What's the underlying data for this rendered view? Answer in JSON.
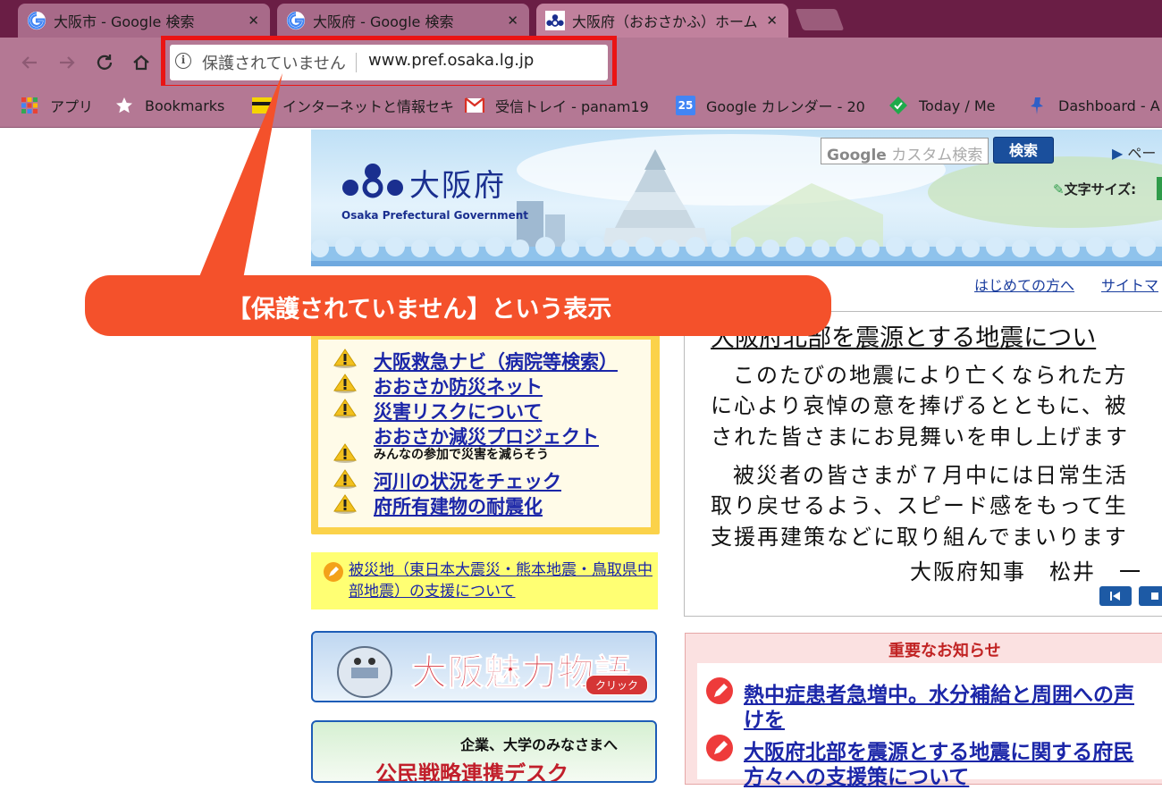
{
  "browser": {
    "tabs": [
      {
        "title": "大阪市 - Google 検索",
        "icon": "google-icon",
        "active": false
      },
      {
        "title": "大阪府 - Google 検索",
        "icon": "google-icon",
        "active": false
      },
      {
        "title": "大阪府（おおさかふ）ホーム",
        "icon": "osaka-pref-icon",
        "active": true
      }
    ],
    "close_glyph": "✕",
    "security_label": "保護されていません",
    "url": "www.pref.osaka.lg.jp",
    "bookmarks": [
      {
        "label": "アプリ",
        "icon": "apps-grid-icon"
      },
      {
        "label": "Bookmarks",
        "icon": "star-icon"
      },
      {
        "label": "インターネットと情報セキ",
        "icon": "internet-watch-icon"
      },
      {
        "label": "受信トレイ - panam19",
        "icon": "gmail-icon"
      },
      {
        "label": "Google カレンダー - 20",
        "icon": "calendar-icon"
      },
      {
        "label": "Today / Me",
        "icon": "today-me-icon"
      },
      {
        "label": "Dashboard - A",
        "icon": "dashboard-pin-icon"
      }
    ],
    "calendar_day": "25"
  },
  "site": {
    "logo_text": "大阪府",
    "logo_sub": "Osaka Prefectural Government",
    "search_placeholder": "カスタム検索",
    "search_brand": "Google",
    "search_button": "検索",
    "page_link": "ペー",
    "font_size_label": "文字サイズ:",
    "sub_links": [
      "はじめての方へ",
      "サイトマ"
    ],
    "disaster_links": [
      "大阪救急ナビ（病院等検索）",
      "おおさか防災ネット",
      "災害リスクについて",
      "おおさか減災プロジェクト",
      "河川の状況をチェック",
      "府所有建物の耐震化"
    ],
    "disaster_note": "みんなの参加で災害を減らそう",
    "support_link": "被災地（東日本大震災・熊本地震・鳥取県中部地震）の支援について",
    "banner1_title": "大阪魅力物語",
    "banner1_click": "クリック",
    "banner2_title": "企業、大学のみなさまへ",
    "banner2_sub": "公民戦略連携デスク",
    "message_title": "大阪府北部を震源とする地震につい",
    "message_lines": [
      "このたびの地震により亡くなられた方",
      "に心より哀悼の意を捧げるとともに、被",
      "された皆さまにお見舞いを申し上げます",
      "被災者の皆さまが７月中には日常生活",
      "取り戻せるよう、スピード感をもって生",
      "支援再建策などに取り組んでまいります",
      "大阪府知事　松井　一"
    ],
    "notice_heading": "重要なお知らせ",
    "notices": [
      "熱中症患者急増中。水分補給と周囲への声",
      "けを",
      "大阪府北部を震源とする地震に関する府民",
      "方々への支援策について"
    ]
  },
  "callout": {
    "text": "【保護されていません】という表示",
    "color": "#f4512b"
  },
  "colors": {
    "tabstrip": "#6a1e45",
    "toolbar": "#b47894",
    "highlight": "#ea1414",
    "link": "#1b26a8"
  }
}
